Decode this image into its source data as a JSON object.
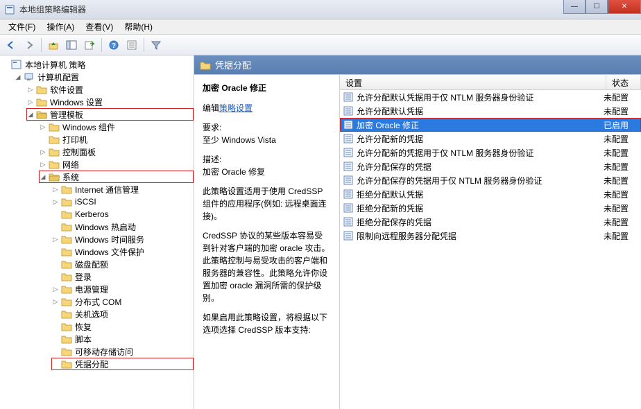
{
  "window": {
    "title": "本地组策略编辑器"
  },
  "menubar": {
    "file": "文件(F)",
    "action": "操作(A)",
    "view": "查看(V)",
    "help": "帮助(H)"
  },
  "tree": {
    "root": "本地计算机 策略",
    "computer_cfg": "计算机配置",
    "software_settings": "软件设置",
    "windows_settings": "Windows 设置",
    "admin_templates": "管理模板",
    "windows_components": "Windows 组件",
    "printers": "打印机",
    "control_panel": "控制面板",
    "network": "网络",
    "system": "系统",
    "internet_comm": "Internet 通信管理",
    "iscsi": "iSCSI",
    "kerberos": "Kerberos",
    "windows_hotstart": "Windows 热启动",
    "windows_time": "Windows 时间服务",
    "windows_file_protect": "Windows 文件保护",
    "disk_quota": "磁盘配额",
    "logon": "登录",
    "power_mgmt": "电源管理",
    "dcom": "分布式 COM",
    "shutdown_options": "关机选项",
    "recovery": "恢复",
    "scripts": "脚本",
    "removable_storage": "可移动存储访问",
    "cred_delegation": "凭据分配"
  },
  "right": {
    "header_title": "凭据分配",
    "detail_title": "加密 Oracle 修正",
    "edit_prefix": "编辑",
    "edit_link": "策略设置",
    "req_label": "要求:",
    "req_value": "至少 Windows Vista",
    "desc_label": "描述:",
    "desc_value": "加密 Oracle 修复",
    "desc_para1": "此策略设置适用于使用 CredSSP 组件的应用程序(例如: 远程桌面连接)。",
    "desc_para2": "CredSSP 协议的某些版本容易受到针对客户端的加密 oracle 攻击。此策略控制与易受攻击的客户端和服务器的兼容性。此策略允许你设置加密 oracle 漏洞所需的保护级别。",
    "desc_para3": "如果启用此策略设置，将根据以下选项选择 CredSSP 版本支持:"
  },
  "list": {
    "col_setting": "设置",
    "col_state": "状态",
    "state_unconfigured": "未配置",
    "state_enabled": "已启用",
    "items": [
      {
        "label": "允许分配默认凭据用于仅 NTLM 服务器身份验证",
        "state": "未配置"
      },
      {
        "label": "允许分配默认凭据",
        "state": "未配置"
      },
      {
        "label": "加密 Oracle 修正",
        "state": "已启用",
        "selected": true,
        "redbox": true
      },
      {
        "label": "允许分配新的凭据",
        "state": "未配置"
      },
      {
        "label": "允许分配新的凭据用于仅 NTLM 服务器身份验证",
        "state": "未配置"
      },
      {
        "label": "允许分配保存的凭据",
        "state": "未配置"
      },
      {
        "label": "允许分配保存的凭据用于仅 NTLM 服务器身份验证",
        "state": "未配置"
      },
      {
        "label": "拒绝分配默认凭据",
        "state": "未配置"
      },
      {
        "label": "拒绝分配新的凭据",
        "state": "未配置"
      },
      {
        "label": "拒绝分配保存的凭据",
        "state": "未配置"
      },
      {
        "label": "限制向远程服务器分配凭据",
        "state": "未配置"
      }
    ]
  }
}
